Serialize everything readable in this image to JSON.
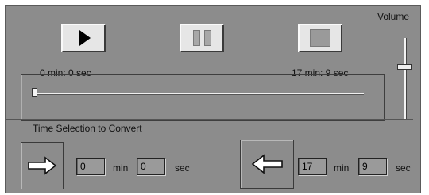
{
  "player": {
    "volume_label": "Volume",
    "elapsed_label": "0 min: 0 sec",
    "total_label": "17 min: 9 sec",
    "seek_position": 0,
    "volume_level": 0.65,
    "buttons": {
      "play": "play-icon",
      "pause": "pause-icon",
      "stop": "stop-icon"
    }
  },
  "conversion": {
    "section_label": "Time Selection to Convert",
    "start": {
      "min_value": "0",
      "min_unit": "min",
      "sec_value": "0",
      "sec_unit": "sec"
    },
    "end": {
      "min_value": "17",
      "min_unit": "min",
      "sec_value": "9",
      "sec_unit": "sec"
    }
  }
}
